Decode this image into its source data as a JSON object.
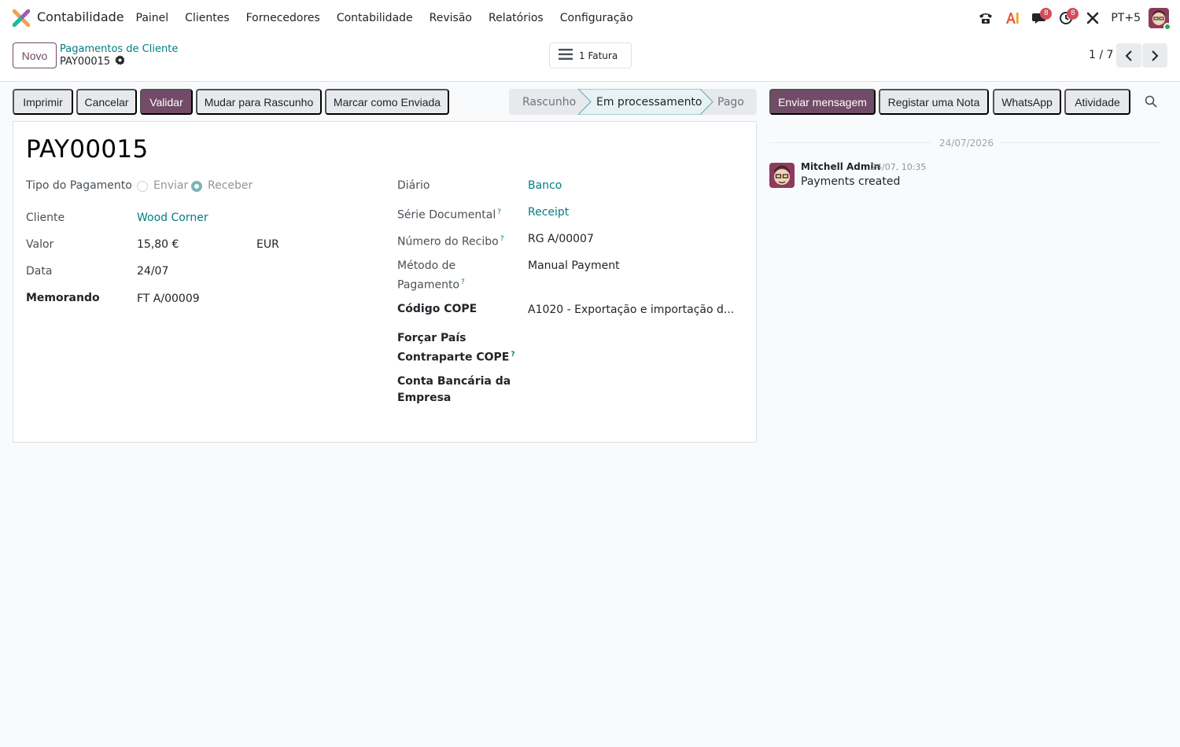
{
  "navbar": {
    "app_name": "Contabilidade",
    "menu": [
      "Painel",
      "Clientes",
      "Fornecedores",
      "Contabilidade",
      "Revisão",
      "Relatórios",
      "Configuração"
    ],
    "messages_badge": "8",
    "activities_badge": "8",
    "company_label": "PT+5"
  },
  "control_panel": {
    "new_button": "Novo",
    "breadcrumb_parent": "Pagamentos de Cliente",
    "breadcrumb_current": "PAY00015",
    "smart_button": "1 Fatura",
    "pager": "1 / 7"
  },
  "actions": {
    "print": "Imprimir",
    "cancel": "Cancelar",
    "validate": "Validar",
    "to_draft": "Mudar para Rascunho",
    "mark_sent": "Marcar como Enviada"
  },
  "statusbar": [
    "Rascunho",
    "Em processamento",
    "Pago"
  ],
  "statusbar_active": "Em processamento",
  "form": {
    "title": "PAY00015",
    "payment_type_label": "Tipo do Pagamento",
    "payment_type_options": [
      "Enviar",
      "Receber"
    ],
    "payment_type_selected": "Receber",
    "customer_label": "Cliente",
    "customer_value": "Wood Corner",
    "amount_label": "Valor",
    "amount_value": "15,80 €",
    "currency_value": "EUR",
    "date_label": "Data",
    "date_value": "24/07",
    "memo_label": "Memorando",
    "memo_value": "FT A/00009",
    "journal_label": "Diário",
    "journal_value": "Banco",
    "series_label": "Série Documental",
    "series_value": "Receipt",
    "receipt_number_label": "Número do Recibo",
    "receipt_number_value": "RG A/00007",
    "payment_method_label_1": "Método de",
    "payment_method_label_2": "Pagamento",
    "payment_method_value": "Manual Payment",
    "cope_code_label": "Código COPE",
    "cope_code_value": "A1020 - Exportação e importação d...",
    "force_country_label_1": "Forçar País",
    "force_country_label_2": "Contraparte COPE",
    "company_bank_label_1": "Conta Bancária da",
    "company_bank_label_2": "Empresa",
    "help_mark": "?"
  },
  "chatter": {
    "send_message": "Enviar mensagem",
    "log_note": "Registar uma Nota",
    "whatsapp": "WhatsApp",
    "activity": "Atividade",
    "date_separator": "24/07/2026",
    "message": {
      "author": "Mitchell Admin",
      "time": "24/07, 10:35",
      "body": "Payments created"
    }
  },
  "colors": {
    "brand": "#714b67",
    "link": "#017e84",
    "badge": "#d44c59"
  }
}
